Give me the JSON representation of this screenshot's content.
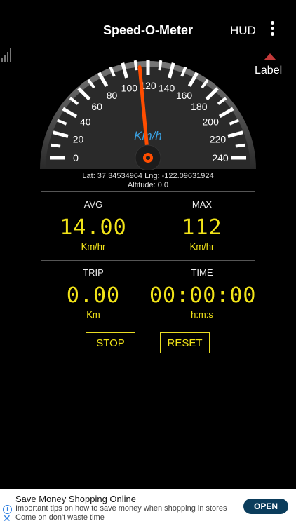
{
  "app": {
    "title": "Speed-O-Meter",
    "hud_label": "HUD",
    "label_button": "Label"
  },
  "gauge": {
    "unit_label": "Km/h",
    "ticks": [
      "0",
      "20",
      "40",
      "60",
      "80",
      "100",
      "120",
      "140",
      "160",
      "180",
      "200",
      "220",
      "240"
    ],
    "needle_speed": 113,
    "max_speed": 240
  },
  "location": {
    "coords_line": "Lat: 37.34534964  Lng: -122.09631924",
    "altitude_line": "Altitude: 0.0"
  },
  "stats": {
    "avg": {
      "label": "AVG",
      "value": "14.00",
      "unit": "Km/hr"
    },
    "max": {
      "label": "MAX",
      "value": "112",
      "unit": "Km/hr"
    },
    "trip": {
      "label": "TRIP",
      "value": "0.00",
      "unit": "Km"
    },
    "time": {
      "label": "TIME",
      "value": "00:00:00",
      "unit": "h:m:s"
    }
  },
  "buttons": {
    "stop": "STOP",
    "reset": "RESET"
  },
  "ad": {
    "title": "Save Money Shopping Online",
    "body": "Important tips on how to save money when shopping in stores Come on don't waste time",
    "cta": "OPEN",
    "info_icon": "info-icon",
    "close_icon": "close-icon"
  },
  "colors": {
    "accent": "#f2e418",
    "needle": "#ff4d00",
    "unit": "#3aa0e0"
  }
}
